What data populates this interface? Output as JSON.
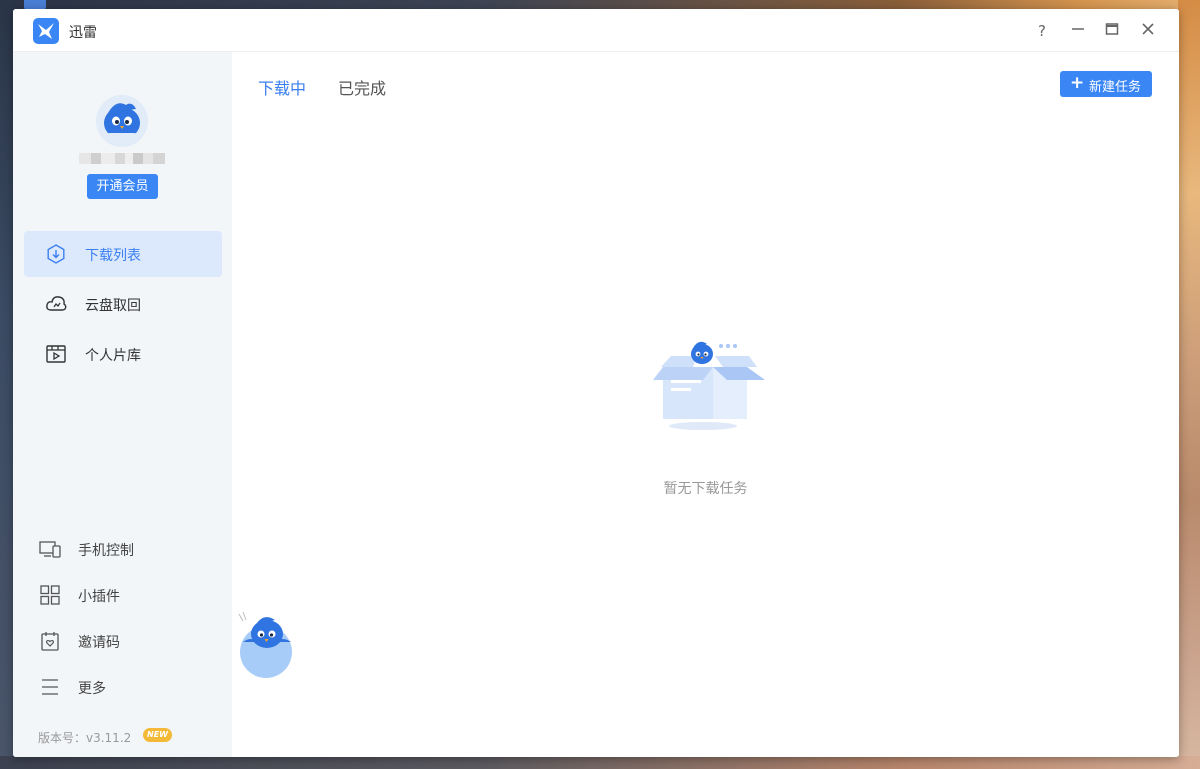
{
  "window": {
    "title": "迅雷",
    "controls": {
      "help": "?",
      "minimize": "—",
      "maximize": "▭",
      "close": "✕"
    }
  },
  "sidebar": {
    "vip_button": "开通会员",
    "nav": [
      {
        "label": "下载列表",
        "icon": "download-circle-icon",
        "active": true
      },
      {
        "label": "云盘取回",
        "icon": "cloud-icon",
        "active": false
      },
      {
        "label": "个人片库",
        "icon": "film-library-icon",
        "active": false
      }
    ],
    "tools": [
      {
        "label": "手机控制",
        "icon": "devices-icon"
      },
      {
        "label": "小插件",
        "icon": "grid-icon"
      },
      {
        "label": "邀请码",
        "icon": "invite-icon"
      },
      {
        "label": "更多",
        "icon": "menu-icon"
      }
    ],
    "version": {
      "label": "版本号：v3.11.2",
      "badge": "NEW"
    }
  },
  "main": {
    "tabs": [
      {
        "label": "下载中",
        "active": true
      },
      {
        "label": "已完成",
        "active": false
      }
    ],
    "new_task_button": {
      "icon": "+",
      "label": "新建任务"
    },
    "empty_text": "暂无下载任务"
  },
  "colors": {
    "accent": "#3a86f5",
    "sidebar_bg": "#f3f6f9",
    "active_nav_bg": "#dce8fb",
    "badge": "#f5b93a"
  }
}
